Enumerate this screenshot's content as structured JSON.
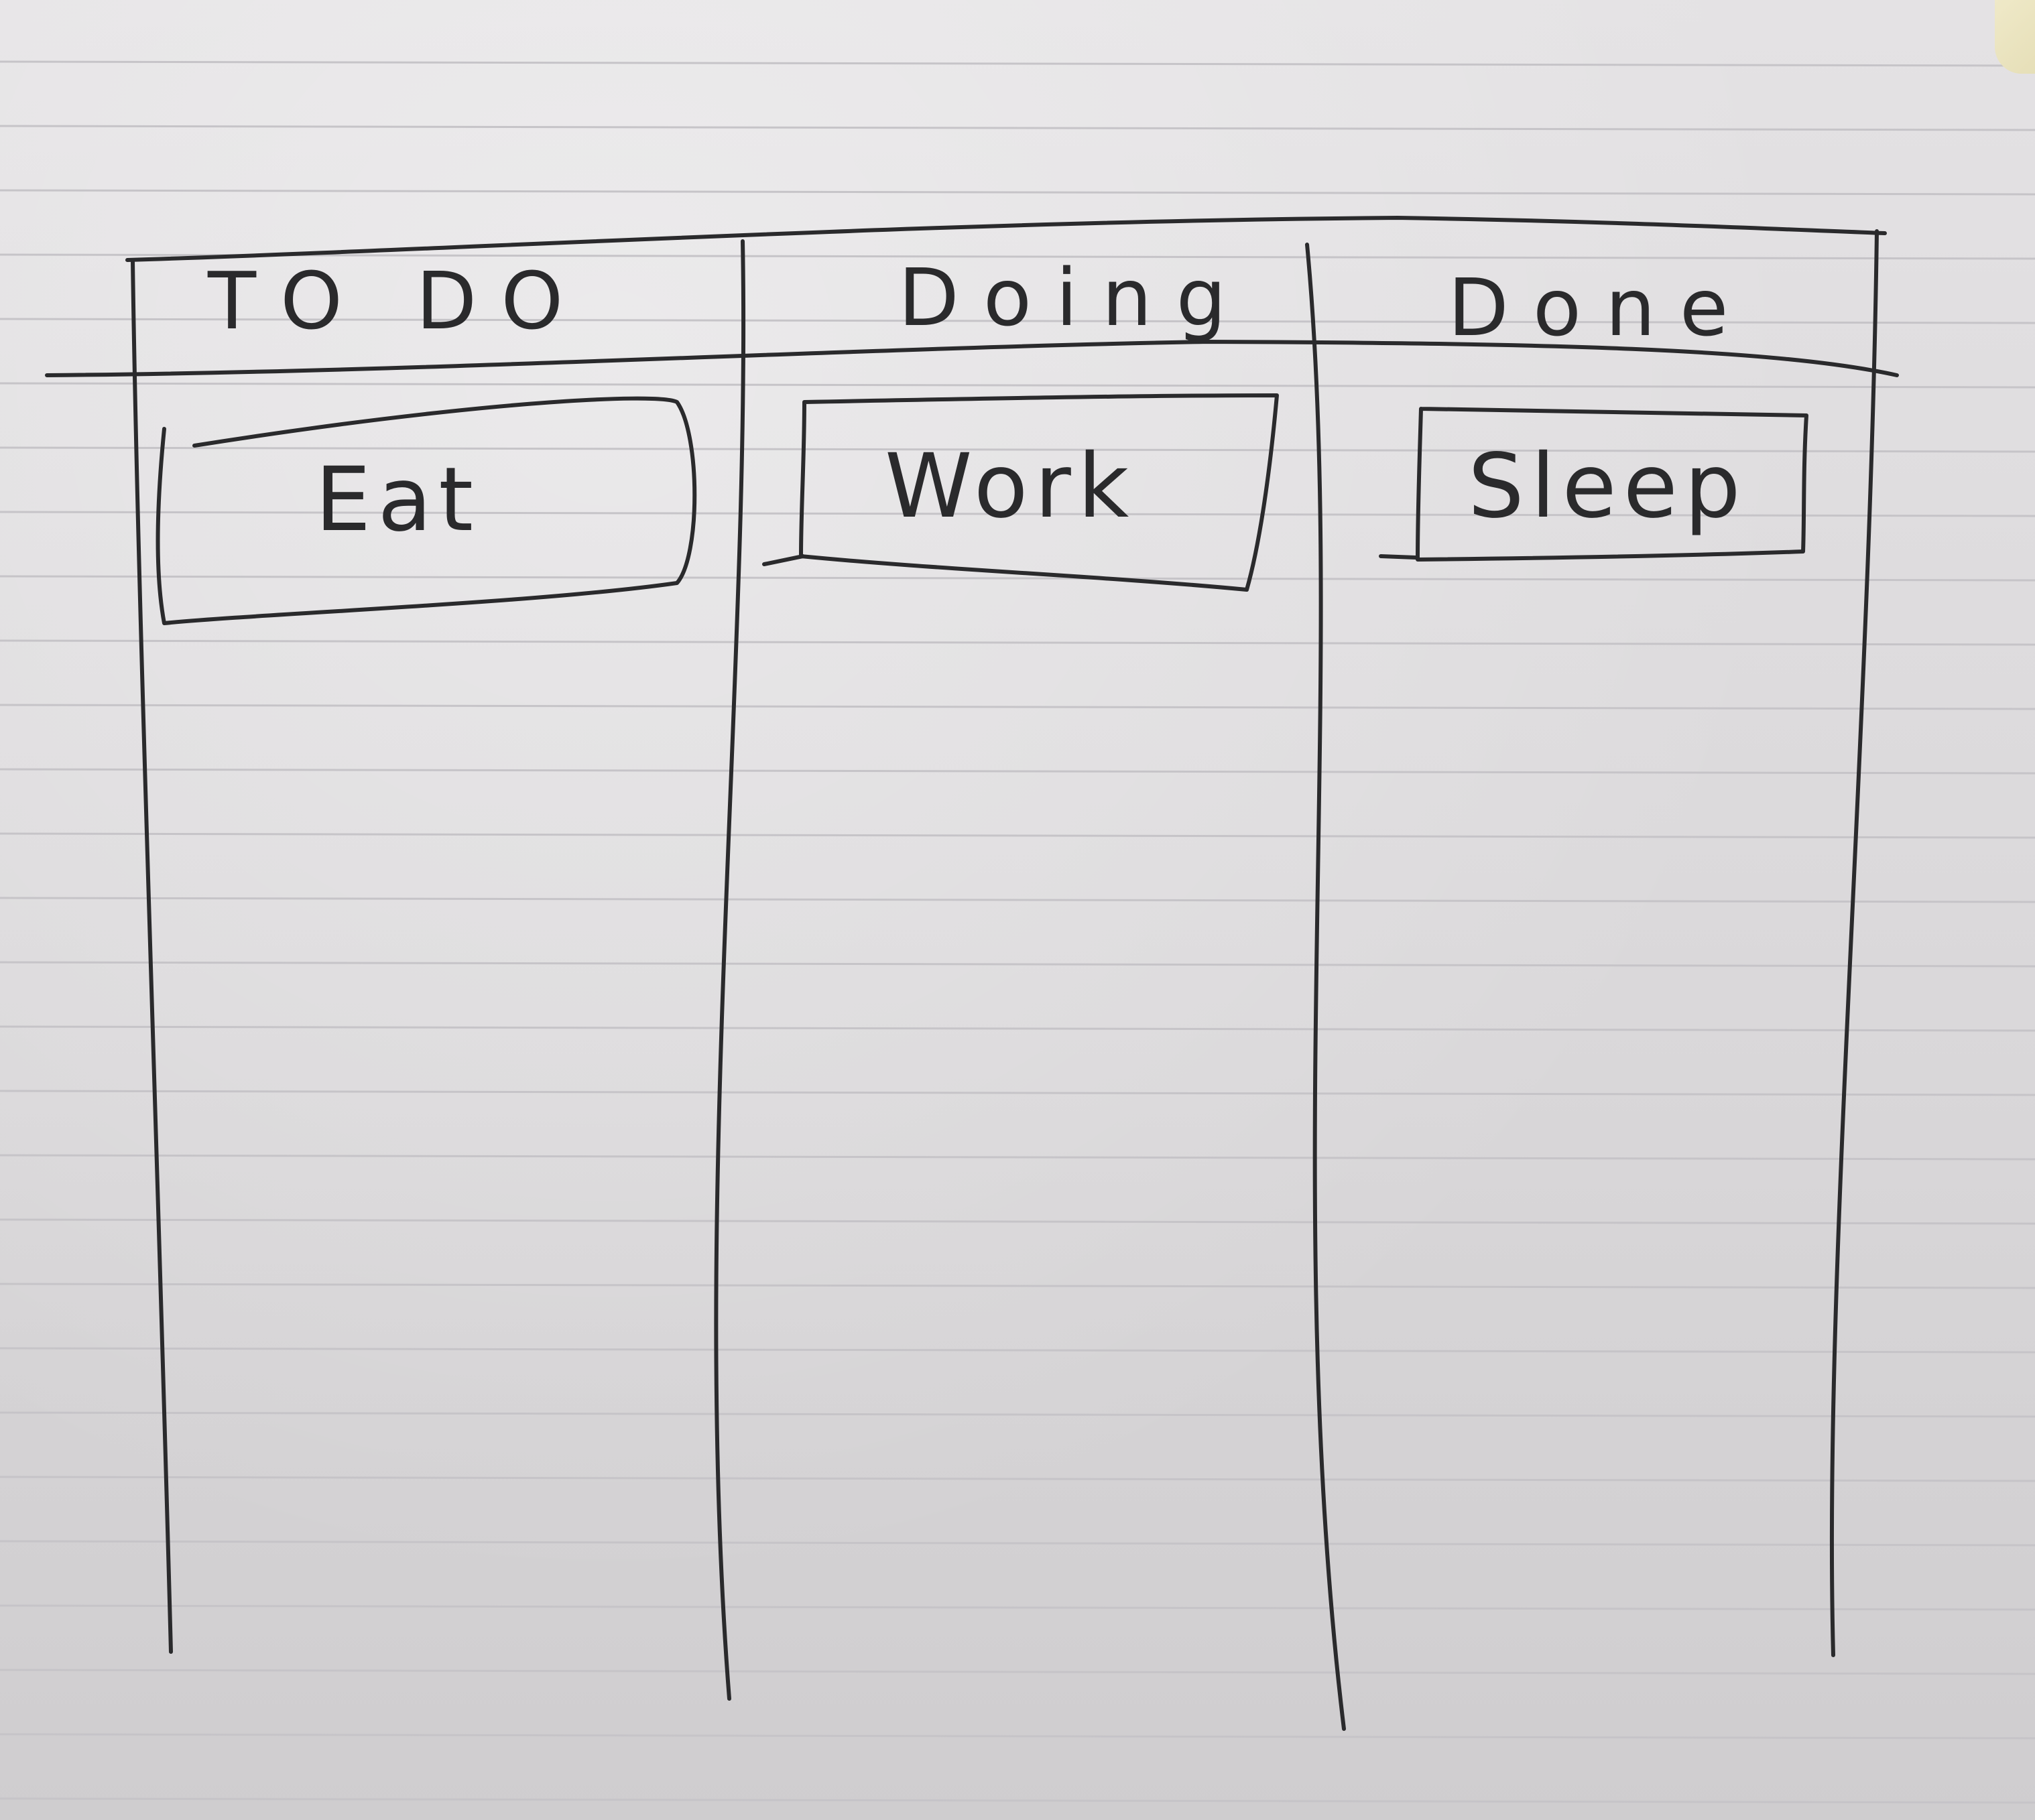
{
  "board": {
    "columns": [
      {
        "title": "TO DO",
        "cards": [
          "Eat"
        ]
      },
      {
        "title": "Doing",
        "cards": [
          "Work"
        ]
      },
      {
        "title": "Done",
        "cards": [
          "Sleep"
        ]
      }
    ]
  },
  "colors": {
    "paper": "#dad8da",
    "ink": "#2a2a2c",
    "rule_line": "#c6c4c8"
  }
}
